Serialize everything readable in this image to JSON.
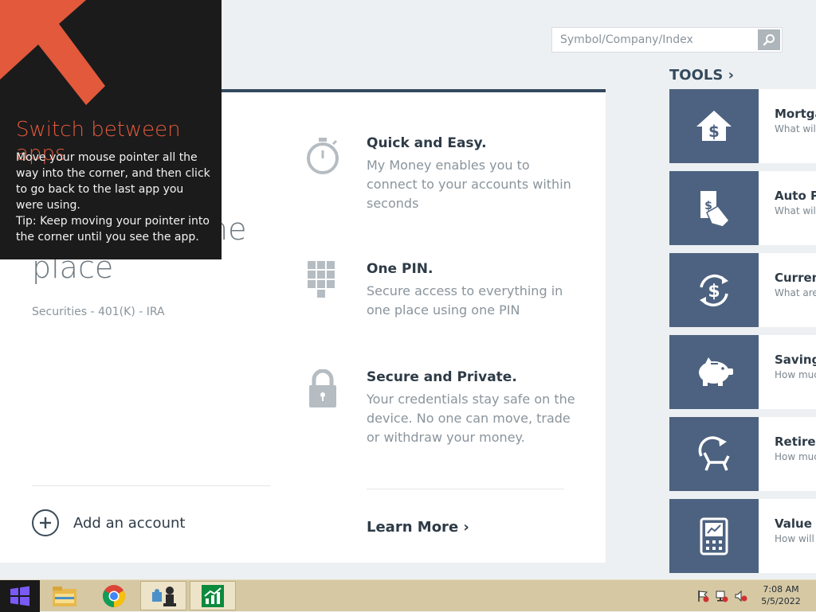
{
  "search": {
    "placeholder": "Symbol/Company/Index"
  },
  "hero": {
    "partial_text": "ne",
    "line2": "place",
    "subtitle": "Securities - 401(K) - IRA"
  },
  "add_account": {
    "label": "Add an account"
  },
  "features": [
    {
      "title": "Quick and Easy.",
      "description": "My Money enables you to connect to your accounts within seconds",
      "icon": "stopwatch-icon"
    },
    {
      "title": "One PIN.",
      "description": "Secure access to everything in one place using one PIN",
      "icon": "keypad-icon"
    },
    {
      "title": "Secure and Private.",
      "description": "Your credentials stay safe on the device. No one can move, trade or withdraw your money.",
      "icon": "lock-icon"
    }
  ],
  "learn_more": {
    "label": "Learn More ›"
  },
  "tools": {
    "heading": "TOOLS ›",
    "items": [
      {
        "name": "Mortga",
        "description": "What will payment l",
        "icon": "house-dollar-icon"
      },
      {
        "name": "Auto Pa",
        "description": "What will payments",
        "icon": "hand-money-icon"
      },
      {
        "name": "Currenc",
        "description": "What are rates?",
        "icon": "currency-cycle-icon"
      },
      {
        "name": "Savings",
        "description": "How much reach my",
        "icon": "piggy-bank-icon"
      },
      {
        "name": "Retirem",
        "description": "How much my retirer",
        "icon": "retirement-chair-icon"
      },
      {
        "name": "Value O",
        "description": "How will r time?",
        "icon": "calculator-chart-icon"
      }
    ]
  },
  "tip": {
    "title": "Switch between apps",
    "body": "Move your mouse pointer all the way into the corner, and then click to go back to the last app you were using.\nTip: Keep moving your pointer into the corner until you see the app."
  },
  "taskbar": {
    "apps": [
      "file-explorer-icon",
      "chrome-icon",
      "puzzle-app-icon",
      "money-app-icon"
    ],
    "time": "7:08 AM",
    "date": "5/5/2022"
  },
  "colors": {
    "accent": "#34495e",
    "tile": "#4d6280",
    "tip_title": "#e2593c",
    "arrow": "#e2593c",
    "taskbar": "#d6c8a3"
  }
}
